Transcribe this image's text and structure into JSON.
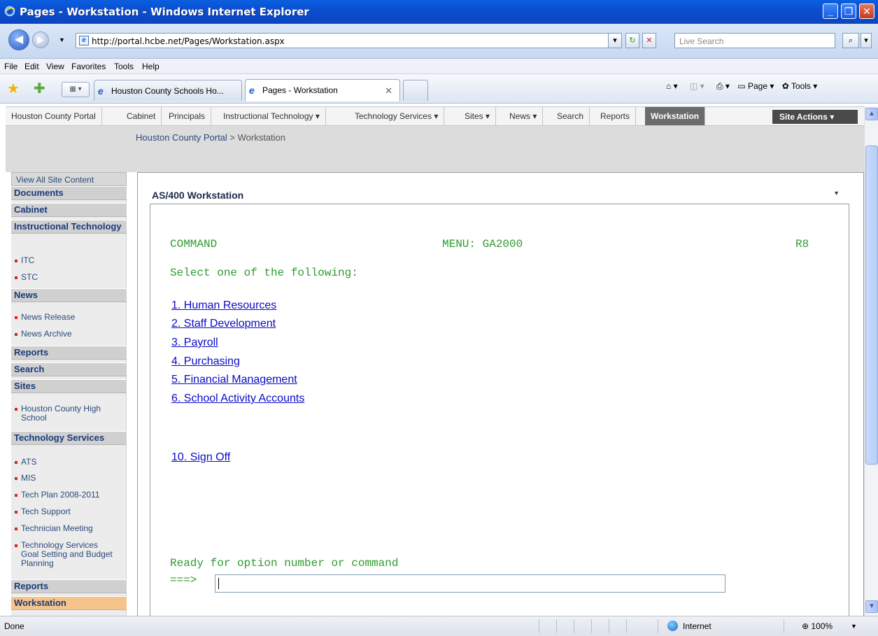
{
  "window": {
    "title": "Pages - Workstation - Windows Internet Explorer",
    "minimize": "_",
    "restore": "❐",
    "close": "✕"
  },
  "address_bar": {
    "back_icon": "◀",
    "forward_icon": "▶",
    "url": "http://portal.hcbe.net/Pages/Workstation.aspx",
    "search_placeholder": "Live Search"
  },
  "menu": {
    "items": [
      "File",
      "Edit",
      "View",
      "Favorites",
      "Tools",
      "Help"
    ]
  },
  "tabs": [
    {
      "label": "Houston County Schools Ho...",
      "active": false
    },
    {
      "label": "Pages - Workstation",
      "active": true,
      "close": "✕"
    }
  ],
  "command_bar": {
    "page": "Page",
    "tools": "Tools"
  },
  "top_nav": {
    "items": [
      "Houston County Portal",
      "Cabinet",
      "Principals",
      "Instructional Technology ▾",
      "Technology Services ▾",
      "Sites ▾",
      "News ▾",
      "Search",
      "Reports",
      "Workstation"
    ],
    "selected": "Workstation",
    "site_actions": "Site Actions ▾"
  },
  "breadcrumb": {
    "root": "Houston County Portal",
    "separator": " > ",
    "current": "Workstation"
  },
  "left_nav": {
    "view_all": "View All Site Content",
    "documents": "Documents",
    "cabinet": "Cabinet",
    "instructional_technology": "Instructional Technology",
    "itc": "ITC",
    "stc": "STC",
    "news": "News",
    "news_release": "News Release",
    "news_archive": "News Archive",
    "reports": "Reports",
    "search": "Search",
    "sites": "Sites",
    "houston_county_high": "Houston County High School",
    "technology_services": "Technology Services",
    "ats": "ATS",
    "mis": "MIS",
    "tech_plan": "Tech Plan 2008-2011",
    "tech_support": "Tech Support",
    "technician_meeting": "Technician Meeting",
    "goal_setting": "Technology Services Goal Setting and Budget Planning",
    "reports2": "Reports",
    "workstation": "Workstation"
  },
  "web_part": {
    "title": "AS/400 Workstation",
    "menu_icon": "▼"
  },
  "terminal": {
    "command": "COMMAND",
    "menu": "MENU: GA2000",
    "release": "R8",
    "prompt": "Select one of the following:",
    "options": [
      "1. Human Resources",
      "2. Staff Development",
      "3. Payroll",
      "4. Purchasing",
      "5. Financial Management",
      "6. School Activity Accounts"
    ],
    "sign_off": "10. Sign Off",
    "ready": "Ready for option number or command",
    "arrow": "===>"
  },
  "status_bar": {
    "status": "Done",
    "zone": "Internet",
    "zoom": "100%"
  },
  "colors": {
    "title_bar": "#0b4fd0",
    "terminal_text": "#2f9a2f",
    "link": "#0a0ac8",
    "selected_nav": "#6b6b6b",
    "left_nav_selected": "#f6c38a"
  }
}
